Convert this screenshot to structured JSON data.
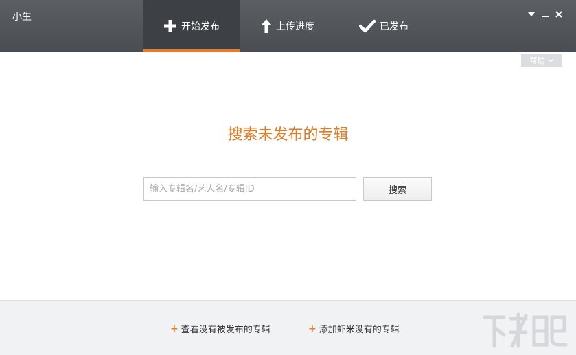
{
  "header": {
    "user_name": "小生",
    "tabs": [
      {
        "label": "开始发布",
        "icon": "plus-icon",
        "active": true
      },
      {
        "label": "上传进度",
        "icon": "arrow-up-icon",
        "active": false
      },
      {
        "label": "已发布",
        "icon": "check-icon",
        "active": false
      }
    ],
    "window_controls": [
      "dropdown-icon",
      "minimize-icon",
      "close-icon"
    ],
    "accent_color": "#f07a21"
  },
  "help": {
    "label": "帮助"
  },
  "main": {
    "heading": "搜索未发布的专辑",
    "search_placeholder": "输入专辑名/艺人名/专辑ID",
    "search_value": "",
    "search_button": "搜索",
    "heading_color": "#e57a1f"
  },
  "footer": {
    "links": [
      {
        "plus": "+",
        "label": "查看没有被发布的专辑"
      },
      {
        "plus": "+",
        "label": "添加虾米没有的专辑"
      }
    ]
  }
}
